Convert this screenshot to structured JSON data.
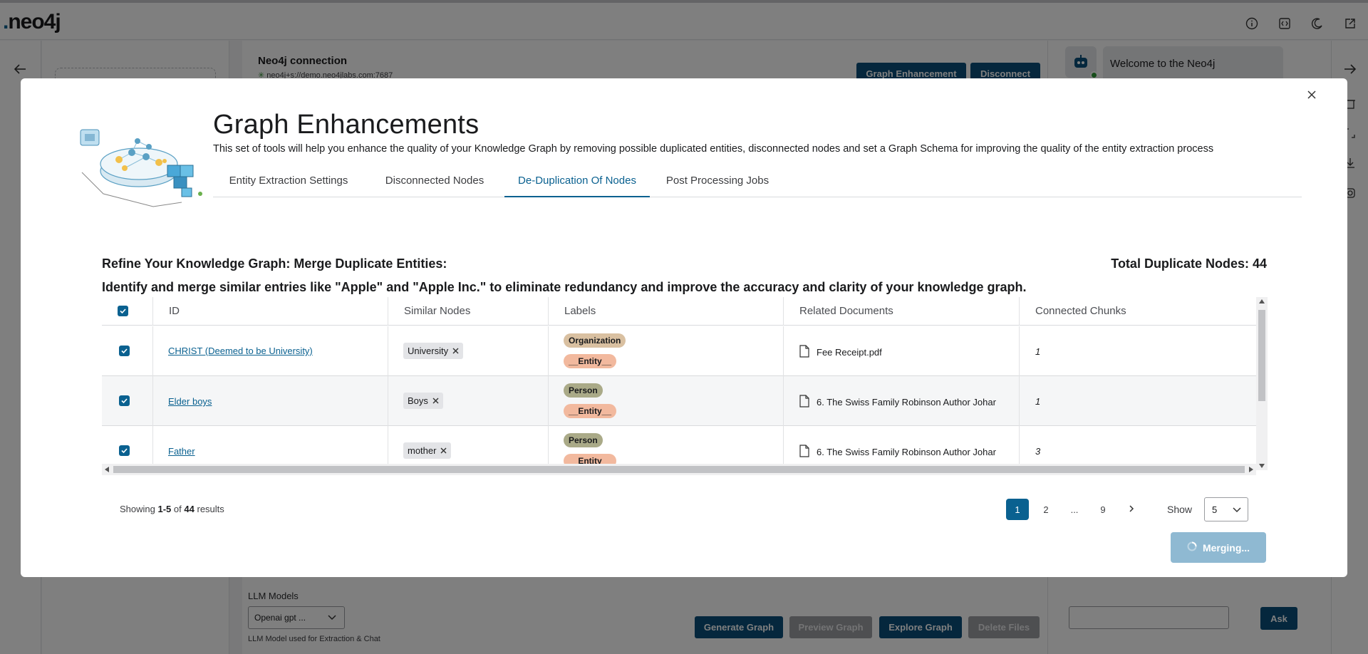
{
  "app": {
    "logo": "neo4j",
    "connection": {
      "title": "Neo4j connection",
      "url": "neo4j+s://demo.neo4jlabs.com:7687",
      "graph_enhancement_label": "Graph Enhancement",
      "disconnect_label": "Disconnect"
    },
    "llm": {
      "label": "LLM Models",
      "selected": "Openai gpt ...",
      "help": "LLM Model used for Extraction & Chat"
    },
    "actions": {
      "generate_graph": "Generate Graph",
      "preview_graph": "Preview Graph",
      "explore_graph": "Explore Graph",
      "delete_files": "Delete Files"
    },
    "chat": {
      "welcome": "Welcome to the Neo4j",
      "ask_label": "Ask"
    }
  },
  "modal": {
    "title": "Graph Enhancements",
    "subtitle": "This set of tools will help you enhance the quality of your Knowledge Graph by removing possible duplicated entities, disconnected nodes and set a Graph Schema for improving the quality of the entity extraction process",
    "tabs": [
      {
        "label": "Entity Extraction Settings",
        "active": false
      },
      {
        "label": "Disconnected Nodes",
        "active": false
      },
      {
        "label": "De-Duplication Of Nodes",
        "active": true
      },
      {
        "label": "Post Processing Jobs",
        "active": false
      }
    ],
    "section_heading": "Refine Your Knowledge Graph: Merge Duplicate Entities:",
    "total_duplicates": "Total Duplicate Nodes: 44",
    "section_desc": "Identify and merge similar entries like \"Apple\" and \"Apple Inc.\" to eliminate redundancy and improve the accuracy and clarity of your knowledge graph.",
    "table": {
      "headers": [
        "ID",
        "Similar Nodes",
        "Labels",
        "Related Documents",
        "Connected Chunks"
      ],
      "rows": [
        {
          "id": "CHRIST (Deemed to be University)",
          "similar": "University",
          "labels": [
            "Organization",
            "__Entity__"
          ],
          "doc": "Fee Receipt.pdf",
          "chunks": "1",
          "checked": true
        },
        {
          "id": "Elder boys",
          "similar": "Boys",
          "labels": [
            "Person",
            "__Entity__"
          ],
          "doc": "6. The Swiss Family Robinson Author Johar",
          "chunks": "1",
          "checked": true
        },
        {
          "id": "Father",
          "similar": "mother",
          "labels": [
            "Person",
            "__Entity__"
          ],
          "doc": "6. The Swiss Family Robinson Author Johar",
          "chunks": "3",
          "checked": true
        }
      ]
    },
    "pagination": {
      "showing_prefix": "Showing",
      "range": "1-5",
      "of": "of",
      "total": "44",
      "suffix": "results",
      "pages": [
        "1",
        "2",
        "...",
        "9"
      ],
      "current": "1",
      "show_label": "Show",
      "page_size": "5"
    },
    "merge_button": "Merging..."
  },
  "colors": {
    "accent": "#0a6190",
    "dark_button": "#0a4f7a",
    "label_organization": "#d9c0a1",
    "label_person": "#aaaa88",
    "label_entity": "#f2b99e"
  }
}
